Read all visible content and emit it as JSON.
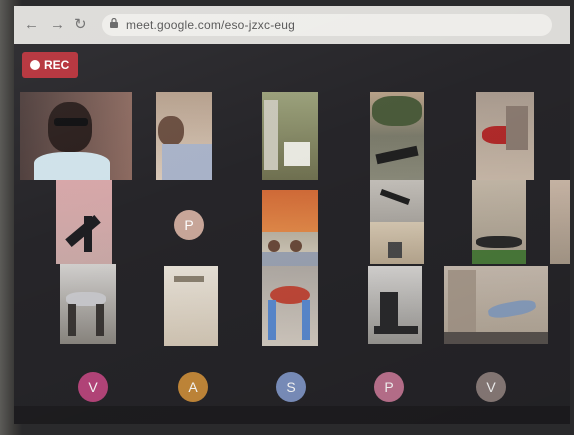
{
  "browser": {
    "back_icon": "arrow-left-icon",
    "forward_icon": "arrow-right-icon",
    "reload_icon": "reload-icon",
    "lock_icon": "lock-icon",
    "url": "meet.google.com/eso-jzxc-eug"
  },
  "meeting": {
    "record_label": "REC",
    "record_color": "#b5313a"
  },
  "participants_row2": {
    "p_letter": "P",
    "p_color": "#c9a79a"
  },
  "participants_row4": [
    {
      "letter": "V",
      "color": "#b8467c"
    },
    {
      "letter": "A",
      "color": "#c68a3a"
    },
    {
      "letter": "S",
      "color": "#7e93c2"
    },
    {
      "letter": "P",
      "color": "#c17592"
    },
    {
      "letter": "V",
      "color": "#8d7f7c"
    }
  ]
}
